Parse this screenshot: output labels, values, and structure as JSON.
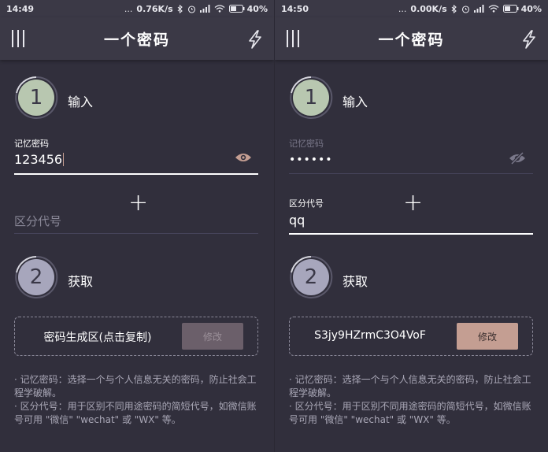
{
  "screens": [
    {
      "status": {
        "time": "14:49",
        "dots": "...",
        "speed": "0.76K/s",
        "battery": "40%"
      },
      "app_title": "一个密码",
      "step1": {
        "number": "1",
        "label": "输入"
      },
      "password": {
        "label": "记忆密码",
        "value": "123456",
        "active": true,
        "eye_state": "visible"
      },
      "plus": "+",
      "code": {
        "label": "区分代号",
        "value": "",
        "active": false
      },
      "step2": {
        "number": "2",
        "label": "获取"
      },
      "result": {
        "text": "密码生成区(点击复制)",
        "button": "修改",
        "button_enabled": false
      },
      "help": [
        "· 记忆密码：选择一个与个人信息无关的密码，防止社会工程学破解。",
        "· 区分代号：用于区别不同用途密码的简短代号，如微信账号可用 \"微信\" \"wechat\" 或 \"WX\" 等。"
      ]
    },
    {
      "status": {
        "time": "14:50",
        "dots": "...",
        "speed": "0.00K/s",
        "battery": "40%"
      },
      "app_title": "一个密码",
      "step1": {
        "number": "1",
        "label": "输入"
      },
      "password": {
        "label": "记忆密码",
        "value": "••••••",
        "active": false,
        "eye_state": "hidden"
      },
      "plus": "+",
      "code": {
        "label": "区分代号",
        "value": "qq",
        "active": true
      },
      "step2": {
        "number": "2",
        "label": "获取"
      },
      "result": {
        "text": "S3jy9HZrmC3O4VoF",
        "button": "修改",
        "button_enabled": true
      },
      "help": [
        "· 记忆密码：选择一个与个人信息无关的密码，防止社会工程学破解。",
        "· 区分代号：用于区别不同用途密码的简短代号，如微信账号可用 \"微信\" \"wechat\" 或 \"WX\" 等。"
      ]
    }
  ],
  "colors": {
    "background": "#312f3c",
    "appbar": "#3b3946",
    "step1_circle": "#b8c7b0",
    "step2_circle": "#a7a6bc",
    "accent_button": "#c49e92",
    "eye_active": "#c49e92"
  },
  "icons": [
    "menu-icon",
    "bolt-icon",
    "eye-icon",
    "eye-off-icon",
    "plus-icon",
    "bluetooth-icon",
    "alarm-icon",
    "signal-icon",
    "wifi-icon",
    "battery-icon"
  ]
}
